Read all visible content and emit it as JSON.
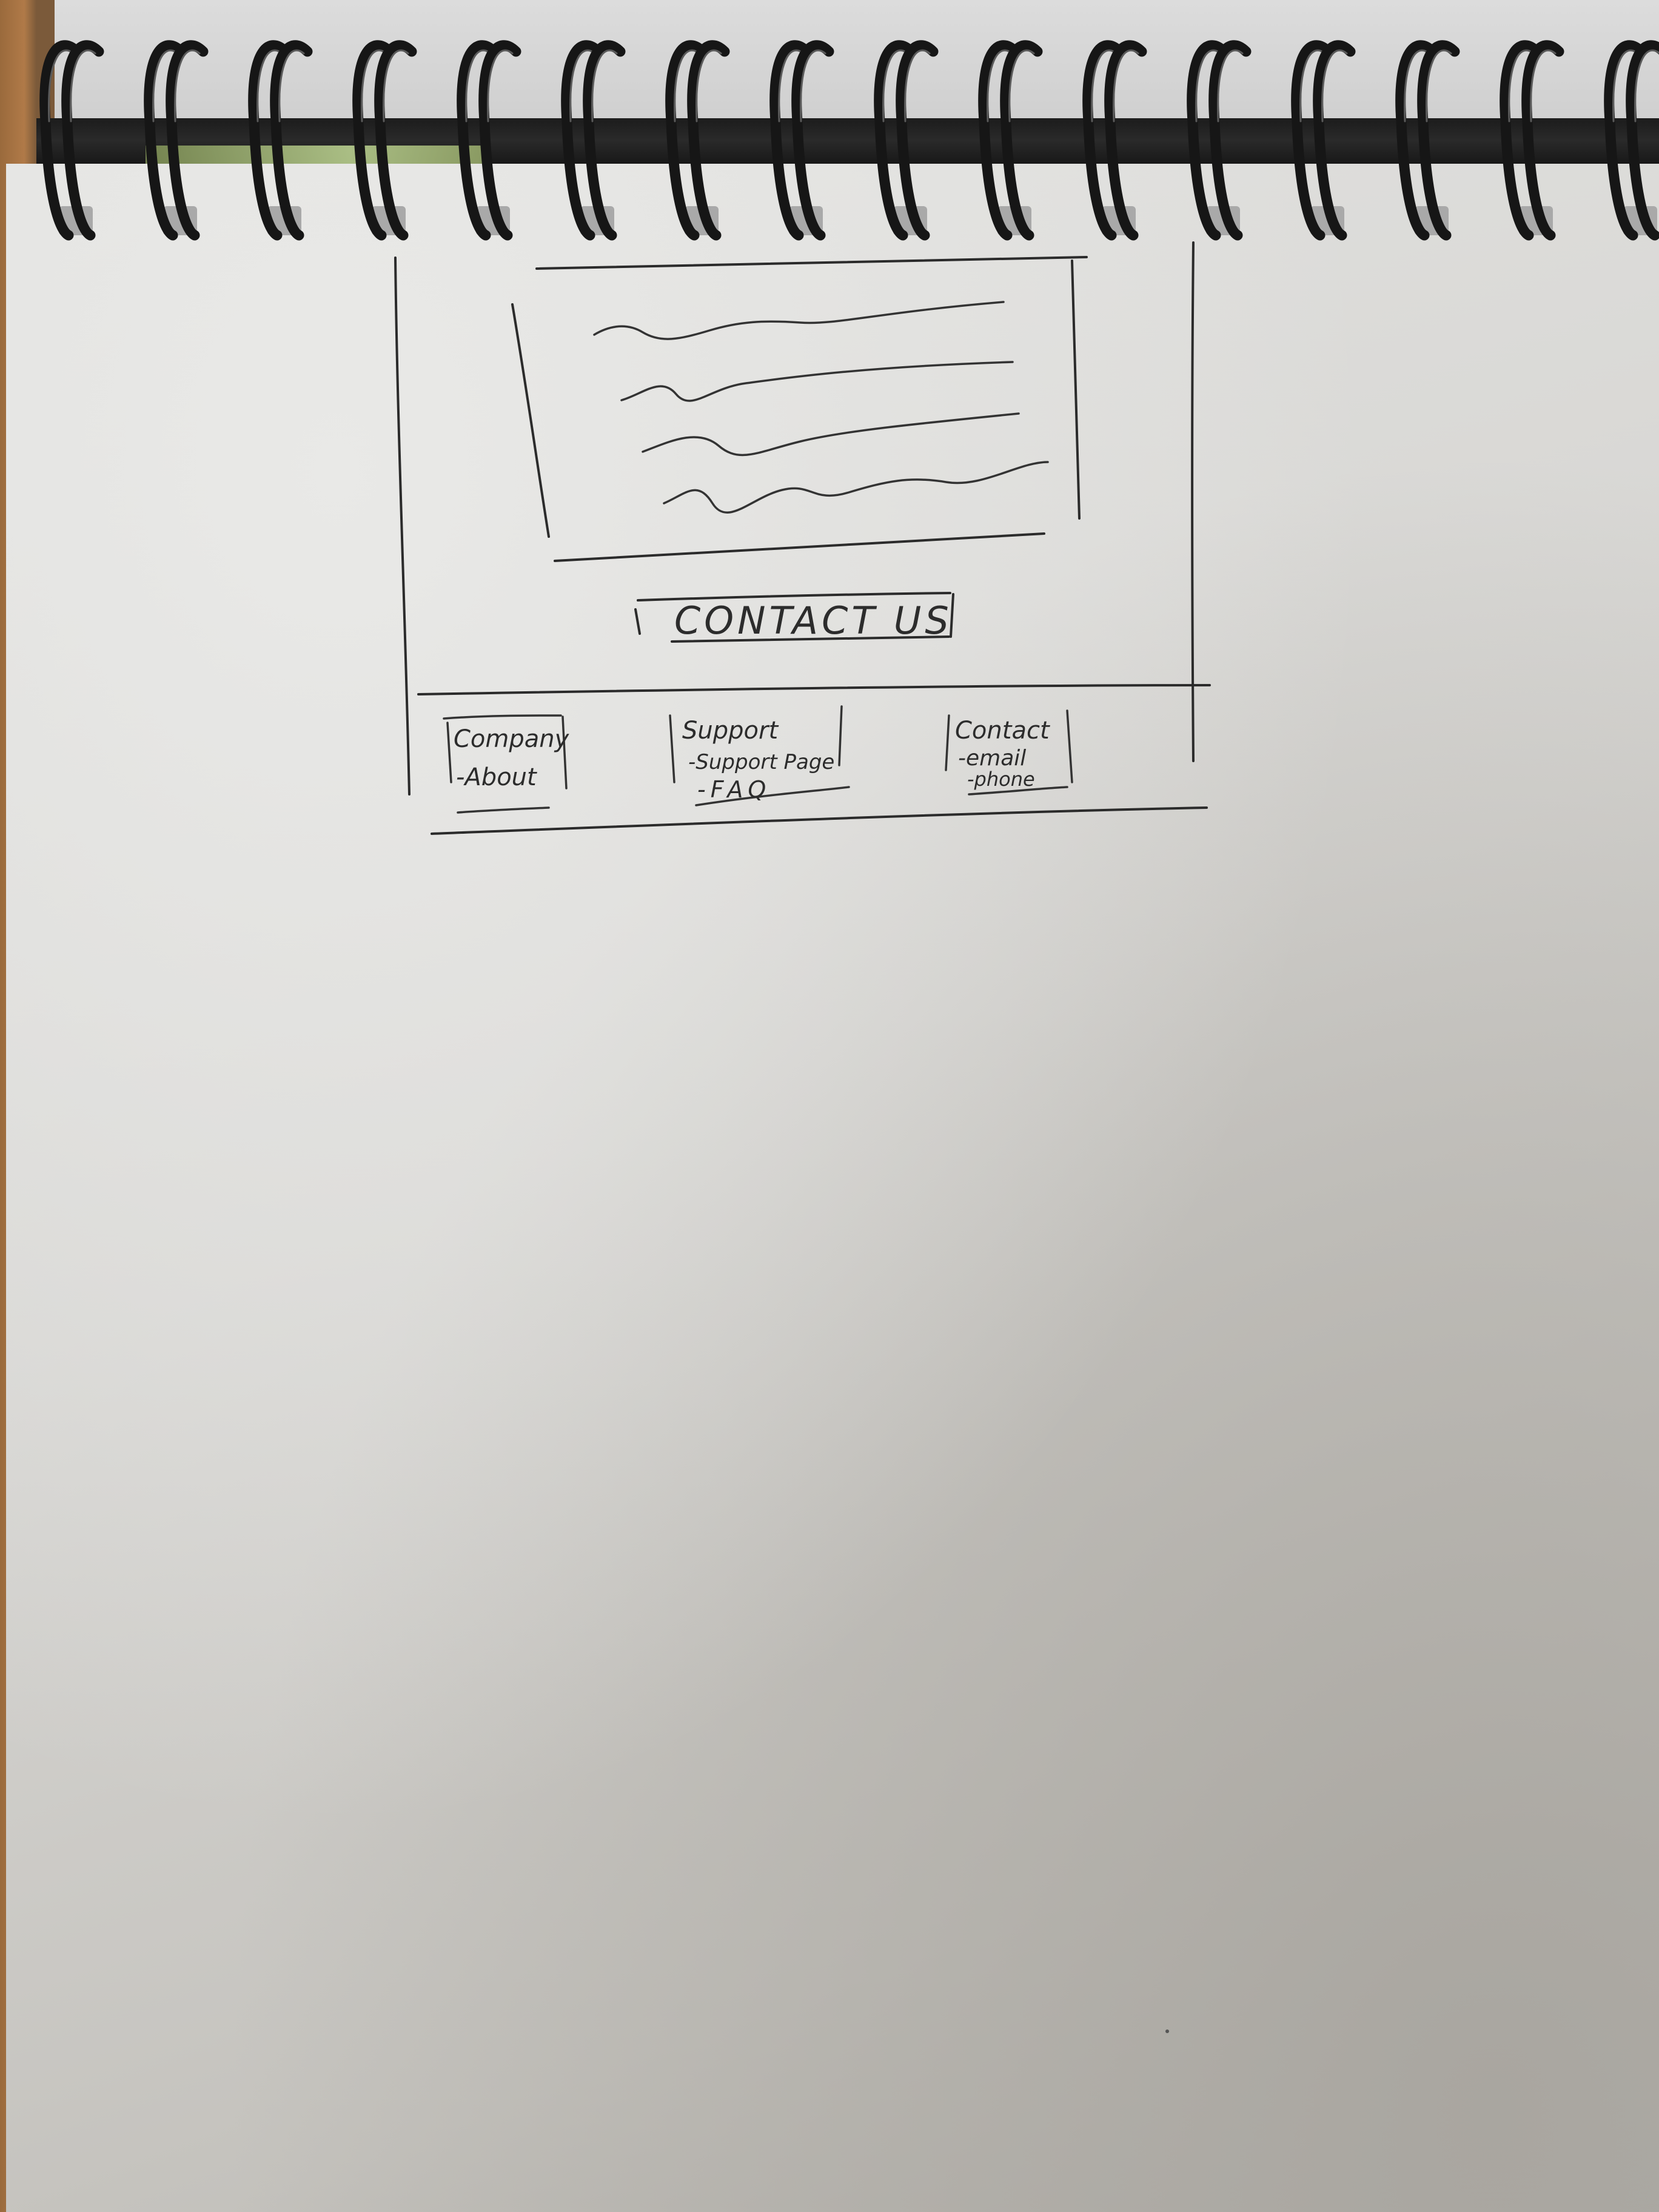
{
  "sketch": {
    "cta_button": {
      "label": "CONTACT US"
    },
    "footer": {
      "columns": [
        {
          "heading": "Company",
          "links": [
            "-About"
          ]
        },
        {
          "heading": "Support",
          "links": [
            "-Support Page",
            "-FAQ"
          ]
        },
        {
          "heading": "Contact",
          "links": [
            "-email",
            "-phone"
          ]
        }
      ]
    }
  },
  "colors": {
    "ink": "#2b2b2b",
    "paper": "#d8d7d4",
    "binding": "#1a1a1a"
  },
  "icons": [
    "spiral-binding-ring"
  ]
}
